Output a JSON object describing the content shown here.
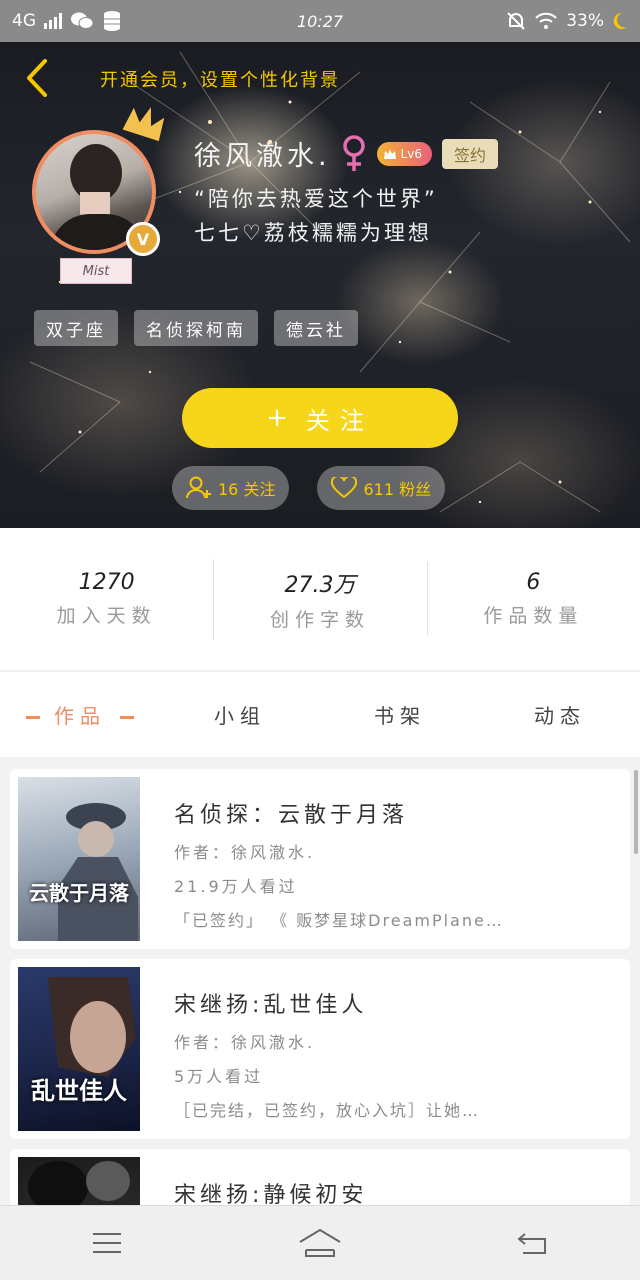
{
  "status_bar": {
    "network": "4G",
    "time": "10:27",
    "battery": "33%",
    "icons": [
      "signal-icon",
      "wechat-icon",
      "database-icon",
      "mute-bell-icon",
      "wifi-icon",
      "moon-icon"
    ]
  },
  "header": {
    "back_icon": "chevron-left-icon",
    "tip": "开通会员，设置个性化背景"
  },
  "profile": {
    "nickname": "徐风澈水.",
    "gender_icon": "female-icon",
    "level": "Lv6",
    "sign_badge": "签约",
    "signature_line1": "“陪你去热爱这个世界”",
    "signature_line2": "七七♡荔枝糯糯为理想",
    "name_tag": "Mist",
    "verified_badge": "V"
  },
  "tags": [
    "双子座",
    "名侦探柯南",
    "德云社"
  ],
  "follow": {
    "plus": "+",
    "label": "关注"
  },
  "social": {
    "following": "16 关注",
    "fans": "611 粉丝"
  },
  "stats": [
    {
      "value": "1270",
      "label": "加入天数"
    },
    {
      "value": "27.3万",
      "label": "创作字数"
    },
    {
      "value": "6",
      "label": "作品数量"
    }
  ],
  "tabs": [
    "作品",
    "小组",
    "书架",
    "动态"
  ],
  "books": [
    {
      "title": "名侦探：云散于月落",
      "author": "作者：徐风澈水.",
      "views": "21.9万人看过",
      "desc": "「已签约」 《 贩梦星球DreamPlane…",
      "cover_text": "云散于月落"
    },
    {
      "title": "宋继扬:乱世佳人",
      "author": "作者：徐风澈水.",
      "views": "5万人看过",
      "desc": "［已完结，已签约，放心入坑］让她…",
      "cover_text": "乱世佳人"
    },
    {
      "title": "宋继扬:静候初安",
      "author": "",
      "views": "",
      "desc": "",
      "cover_text": ""
    }
  ],
  "nav": [
    "menu-icon",
    "home-icon",
    "back-icon"
  ],
  "colors": {
    "accent_orange": "#ef8d63",
    "follow_yellow": "#f7d51b",
    "tip_yellow": "#f5c800"
  }
}
